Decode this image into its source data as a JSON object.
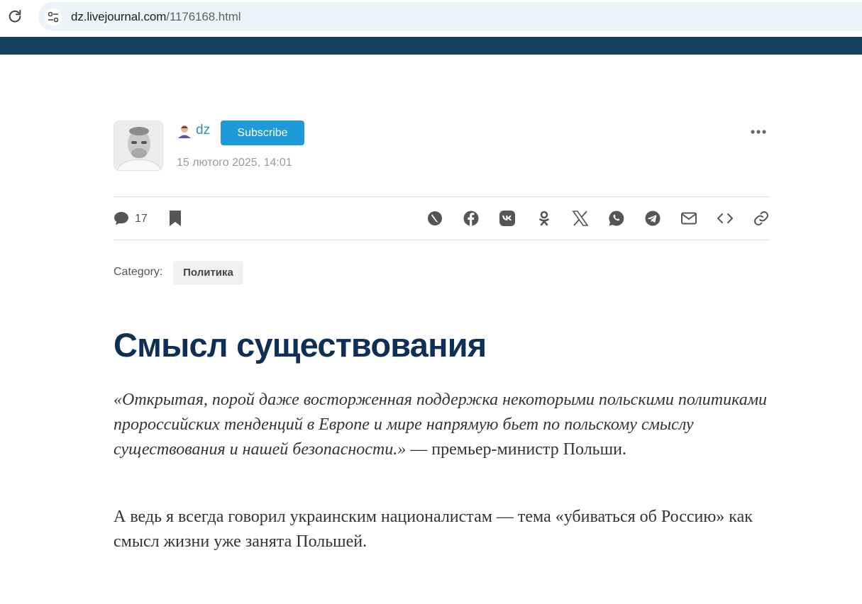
{
  "browser": {
    "url_host": "dz.livejournal.com",
    "url_path": "/1176168.html"
  },
  "author": {
    "username": "dz",
    "subscribe_label": "Subscribe",
    "date": "15 лютого 2025, 14:01"
  },
  "toolbar": {
    "comments_count": "17",
    "share_icons": [
      "livejournal-icon",
      "facebook-icon",
      "vk-icon",
      "odnoklassniki-icon",
      "x-icon",
      "whatsapp-icon",
      "telegram-icon",
      "email-icon",
      "embed-icon",
      "link-icon"
    ]
  },
  "category": {
    "label": "Category:",
    "tag": "Политика"
  },
  "post": {
    "title": "Смысл существования",
    "quote": "«Открытая, порой даже восторженная поддержка некоторыми польскими политиками пророссийских тенденций в Европе и мире напрямую бьет по польскому смыслу существования и нашей безопасности.»",
    "quote_attribution": " — премьер-министр Польши.",
    "paragraph2": "А ведь я всегда говорил украинским националистам — тема «убиваться об Россию» как смысл жизни уже занята Польшей."
  },
  "colors": {
    "header_band": "#12415c",
    "accent": "#1e9ad6",
    "title": "#0f2f56"
  }
}
